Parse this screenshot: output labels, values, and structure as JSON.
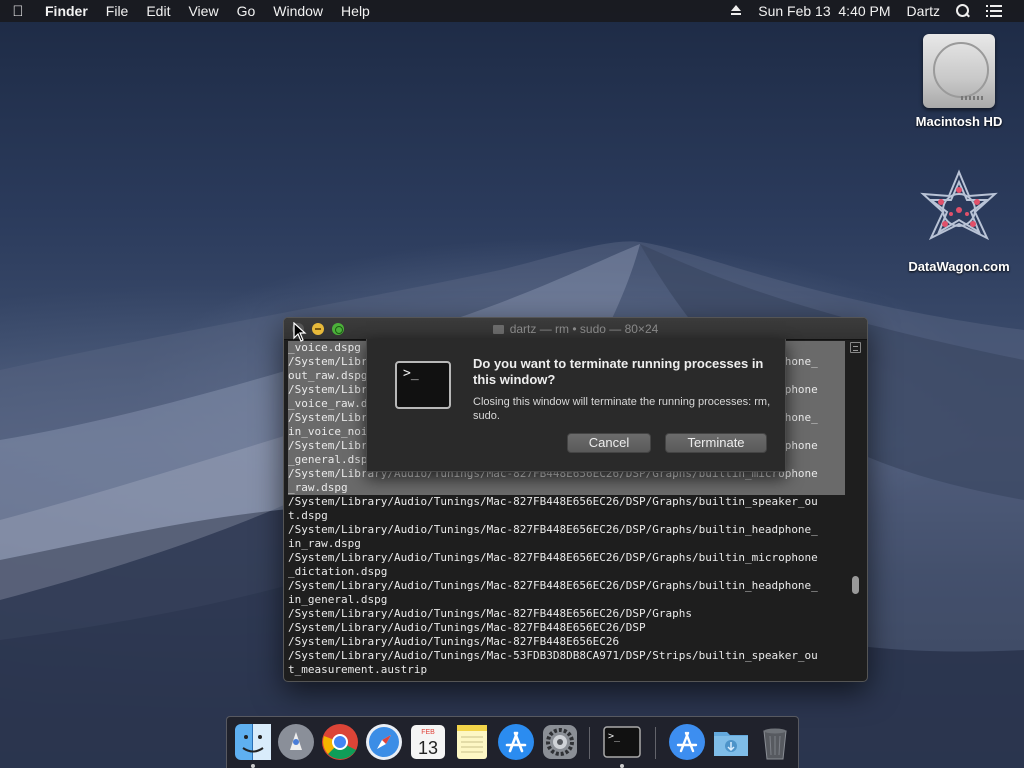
{
  "menubar": {
    "apple": "",
    "items": [
      "Finder",
      "File",
      "Edit",
      "View",
      "Go",
      "Window",
      "Help"
    ],
    "datetime": "Sun Feb 13  4:40 PM",
    "user": "Dartz"
  },
  "desktop": {
    "icons": [
      {
        "label": "Macintosh HD",
        "icon": "hard-drive-icon"
      },
      {
        "label": "DataWagon.com",
        "icon": "datawagon-logo-icon"
      }
    ]
  },
  "terminal": {
    "title": "dartz — rm • sudo — 80×24",
    "lines": [
      {
        "text": "_voice.dspg",
        "selected": true
      },
      {
        "text": "/System/Library/Audio/Tunings/Mac-827FB448E656EC26/DSP/Graphs/builtin_headphone_",
        "selected": true
      },
      {
        "text": "out_raw.dspg",
        "selected": true
      },
      {
        "text": "/System/Library/Audio/Tunings/Mac-827FB448E656EC26/DSP/Graphs/builtin_microphone",
        "selected": true
      },
      {
        "text": "_voice_raw.dspg",
        "selected": true
      },
      {
        "text": "/System/Library/Audio/Tunings/Mac-827FB448E656EC26/DSP/Graphs/builtin_headphone_",
        "selected": true
      },
      {
        "text": "in_voice_noise.dspg",
        "selected": true
      },
      {
        "text": "/System/Library/Audio/Tunings/Mac-827FB448E656EC26/DSP/Graphs/builtin_microphone",
        "selected": true
      },
      {
        "text": "_general.dspg",
        "selected": true
      },
      {
        "text": "/System/Library/Audio/Tunings/Mac-827FB448E656EC26/DSP/Graphs/builtin_microphone",
        "selected": true
      },
      {
        "text": "_raw.dspg",
        "selected": true
      },
      {
        "text": "/System/Library/Audio/Tunings/Mac-827FB448E656EC26/DSP/Graphs/builtin_speaker_ou",
        "selected": false
      },
      {
        "text": "t.dspg",
        "selected": false
      },
      {
        "text": "/System/Library/Audio/Tunings/Mac-827FB448E656EC26/DSP/Graphs/builtin_headphone_",
        "selected": false
      },
      {
        "text": "in_raw.dspg",
        "selected": false
      },
      {
        "text": "/System/Library/Audio/Tunings/Mac-827FB448E656EC26/DSP/Graphs/builtin_microphone",
        "selected": false
      },
      {
        "text": "_dictation.dspg",
        "selected": false
      },
      {
        "text": "/System/Library/Audio/Tunings/Mac-827FB448E656EC26/DSP/Graphs/builtin_headphone_",
        "selected": false
      },
      {
        "text": "in_general.dspg",
        "selected": false
      },
      {
        "text": "/System/Library/Audio/Tunings/Mac-827FB448E656EC26/DSP/Graphs",
        "selected": false
      },
      {
        "text": "/System/Library/Audio/Tunings/Mac-827FB448E656EC26/DSP",
        "selected": false
      },
      {
        "text": "/System/Library/Audio/Tunings/Mac-827FB448E656EC26",
        "selected": false
      },
      {
        "text": "/System/Library/Audio/Tunings/Mac-53FDB3D8DB8CA971/DSP/Strips/builtin_speaker_ou",
        "selected": false
      },
      {
        "text": "t_measurement.austrip",
        "selected": false
      }
    ]
  },
  "dialog": {
    "icon_text": ">_",
    "heading": "Do you want to terminate running processes in this window?",
    "message": "Closing this window will terminate the running processes: rm, sudo.",
    "cancel_label": "Cancel",
    "terminate_label": "Terminate"
  },
  "dock": {
    "calendar_month": "FEB",
    "calendar_day": "13",
    "terminal_glyph": ">_",
    "apps": [
      "finder-icon",
      "launchpad-icon",
      "chrome-icon",
      "safari-icon",
      "calendar-icon",
      "notes-icon",
      "app-store-icon",
      "system-preferences-icon",
      "terminal-icon",
      "applications-folder-icon",
      "downloads-folder-icon",
      "trash-icon"
    ]
  }
}
